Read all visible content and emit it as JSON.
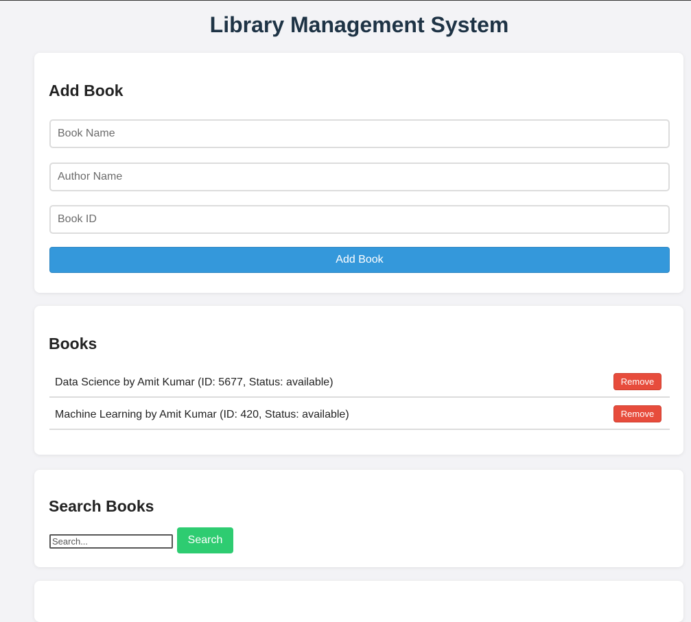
{
  "page": {
    "title": "Library Management System"
  },
  "add_book": {
    "heading": "Add Book",
    "book_name_placeholder": "Book Name",
    "author_name_placeholder": "Author Name",
    "book_id_placeholder": "Book ID",
    "submit_label": "Add Book"
  },
  "books": {
    "heading": "Books",
    "items": [
      {
        "text": "Data Science by Amit Kumar (ID: 5677, Status: available)",
        "remove_label": "Remove"
      },
      {
        "text": "Machine Learning by Amit Kumar (ID: 420, Status: available)",
        "remove_label": "Remove"
      }
    ]
  },
  "search": {
    "heading": "Search Books",
    "placeholder": "Search...",
    "button_label": "Search"
  },
  "colors": {
    "primary": "#3498db",
    "danger": "#e74c3c",
    "success": "#2ecc71",
    "title": "#1e3345",
    "background": "#f3f3f6"
  }
}
